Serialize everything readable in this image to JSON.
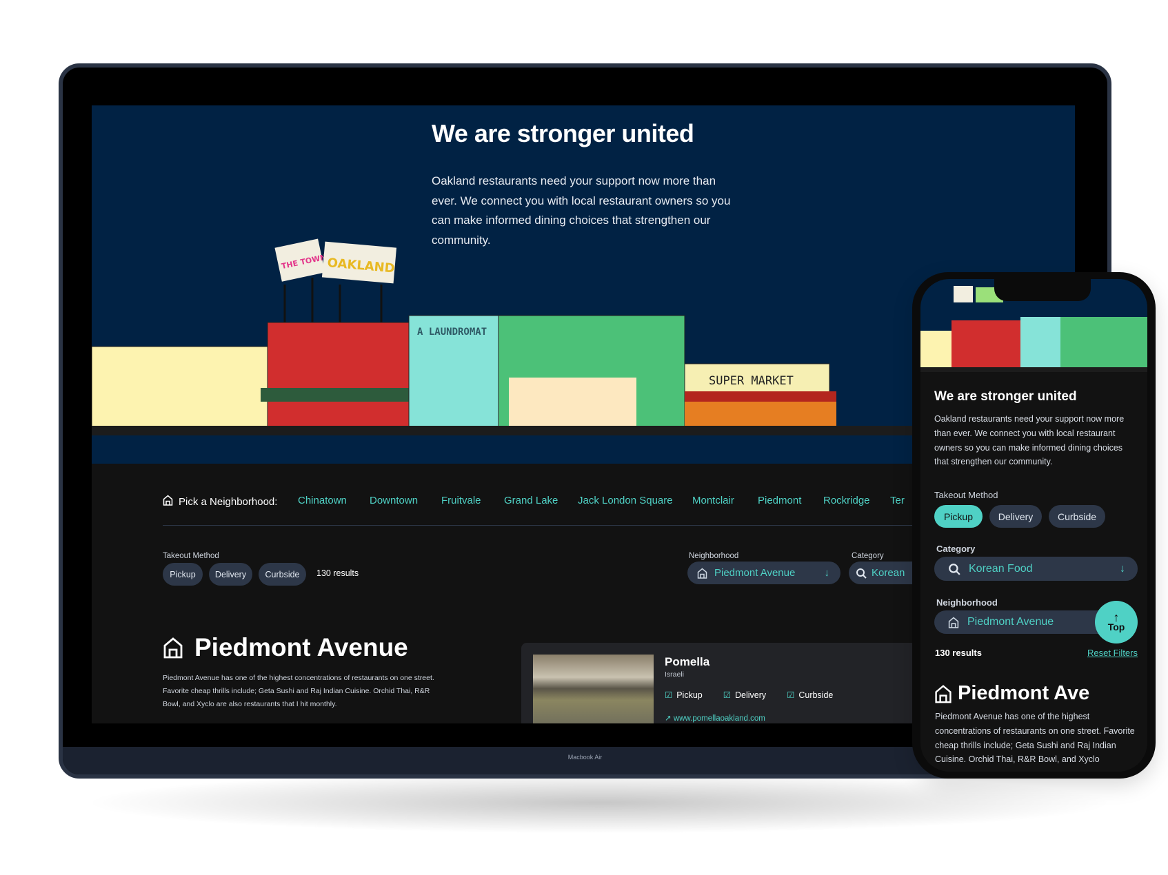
{
  "hero": {
    "title": "We are stronger united",
    "lead": "Oakland restaurants need your support now more than ever. We connect you with local restaurant owners so you can make informed dining choices that strengthen our community."
  },
  "nav": {
    "label": "Pick a Neighborhood:",
    "items": [
      "Chinatown",
      "Downtown",
      "Fruitvale",
      "Grand Lake",
      "Jack London Square",
      "Montclair",
      "Piedmont",
      "Rockridge",
      "Ter"
    ]
  },
  "filters": {
    "takeout_label": "Takeout Method",
    "methods": [
      "Pickup",
      "Delivery",
      "Curbside"
    ],
    "results": "130 results",
    "neighborhood_label": "Neighborhood",
    "neighborhood_value": "Piedmont Avenue",
    "category_label": "Category",
    "category_value": "Korean"
  },
  "section": {
    "title": "Piedmont Avenue",
    "body": "Piedmont Avenue has one of the highest concentrations of restaurants on one street. Favorite cheap thrills include; Geta Sushi and Raj Indian Cuisine. Orchid Thai, R&R Bowl, and Xyclo are also restaurants that I hit monthly."
  },
  "restaurant": {
    "name": "Pomella",
    "cuisine": "Israeli",
    "methods": [
      "Pickup",
      "Delivery",
      "Curbside"
    ],
    "url": "www.pomellaoakland.com"
  },
  "device_label": "Macbook Air",
  "mural": {
    "signs": [
      "THE TOWN",
      "OAKLAND",
      "A LAUNDROMAT",
      "SUPER MARKET"
    ]
  },
  "mobile": {
    "title": "We are stronger united",
    "lead": "Oakland restaurants need your support now more than ever. We connect you with local restaurant owners so you can make informed dining choices that strengthen our community.",
    "takeout_label": "Takeout Method",
    "methods": [
      "Pickup",
      "Delivery",
      "Curbside"
    ],
    "category_label": "Category",
    "category_value": "Korean Food",
    "neighborhood_label": "Neighborhood",
    "neighborhood_value": "Piedmont Avenue",
    "top_label": "Top",
    "results": "130 results",
    "reset": "Reset Filters",
    "section_title": "Piedmont Ave",
    "section_body": "Piedmont Avenue has one of the highest concentrations of restaurants on one street. Favorite cheap thrills include; Geta Sushi and Raj Indian Cuisine. Orchid Thai, R&R Bowl, and Xyclo"
  },
  "colors": {
    "accent": "#4fd1c5",
    "hero_bg": "#012244",
    "page_bg": "#121212",
    "pill_bg": "#2d3748"
  }
}
